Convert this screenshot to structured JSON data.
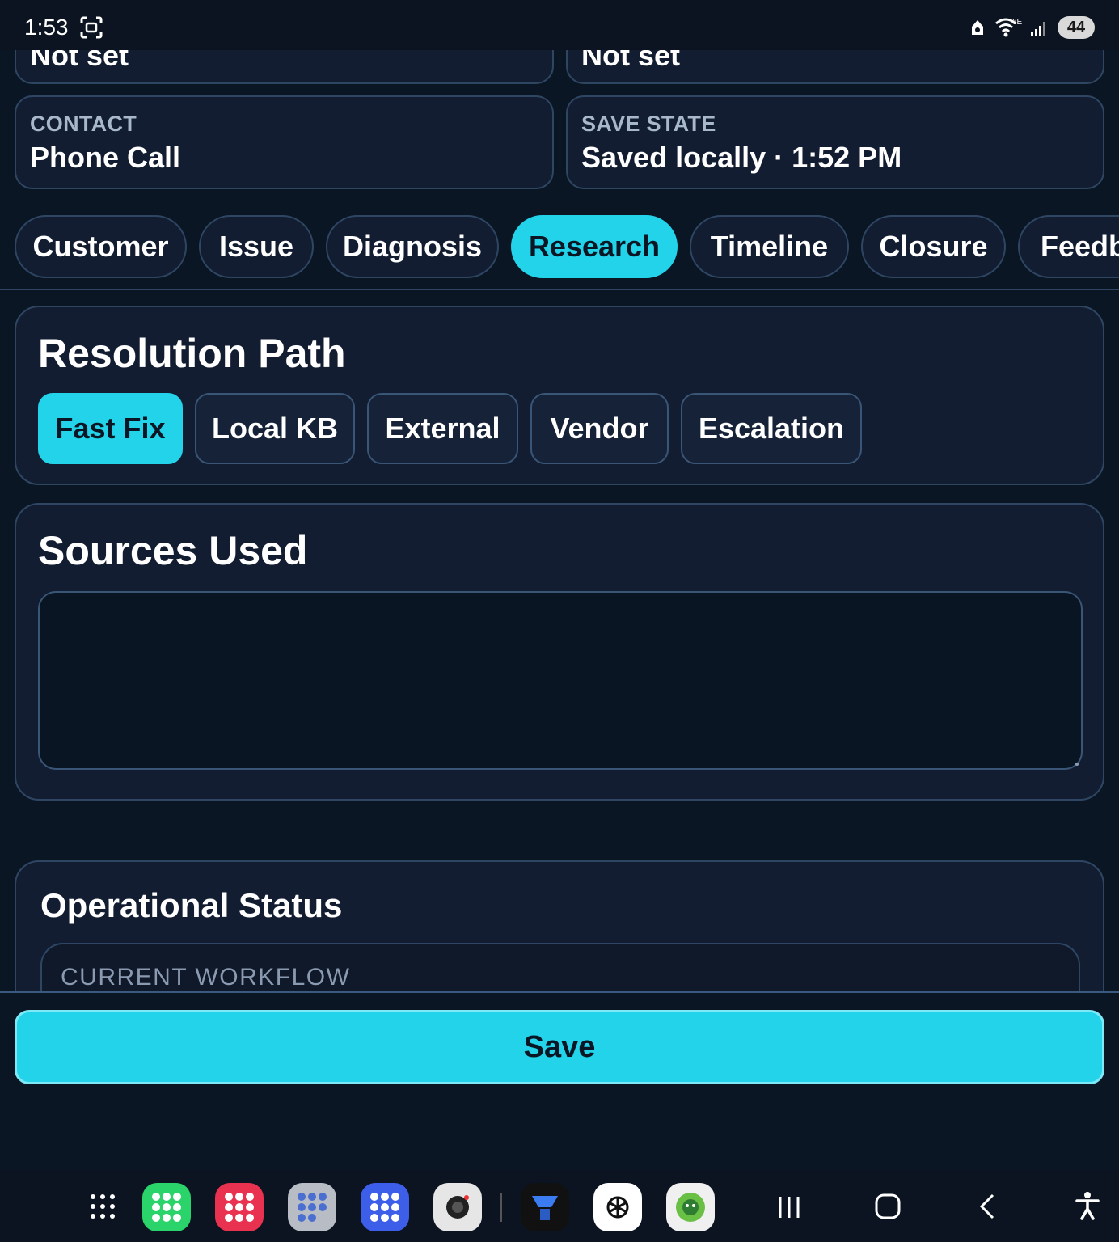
{
  "status_bar": {
    "time": "1:53",
    "network": "6E",
    "battery": "44"
  },
  "info_cards": {
    "top_left_value": "Not set",
    "top_right_value": "Not set",
    "contact_label": "CONTACT",
    "contact_value": "Phone Call",
    "save_state_label": "SAVE STATE",
    "save_state_value": "Saved locally · 1:52 PM"
  },
  "tabs": [
    {
      "label": "Customer",
      "active": false
    },
    {
      "label": "Issue",
      "active": false
    },
    {
      "label": "Diagnosis",
      "active": false
    },
    {
      "label": "Research",
      "active": true
    },
    {
      "label": "Timeline",
      "active": false
    },
    {
      "label": "Closure",
      "active": false
    },
    {
      "label": "Feedb",
      "active": false
    }
  ],
  "resolution_path": {
    "title": "Resolution Path",
    "options": [
      {
        "label": "Fast Fix",
        "active": true
      },
      {
        "label": "Local KB",
        "active": false
      },
      {
        "label": "External",
        "active": false
      },
      {
        "label": "Vendor",
        "active": false
      },
      {
        "label": "Escalation",
        "active": false
      }
    ]
  },
  "sources_used": {
    "title": "Sources Used",
    "value": ""
  },
  "operational_status": {
    "title": "Operational Status",
    "workflow_label": "CURRENT WORKFLOW"
  },
  "footer": {
    "save_label": "Save"
  },
  "colors": {
    "accent": "#22d3ea",
    "background": "#0b1625",
    "card": "#121d31",
    "border": "#2f4663"
  },
  "dock": {
    "apps": [
      "app-folder-green",
      "app-folder-red",
      "app-folder-gray",
      "app-folder-blue",
      "camera-app",
      "tf-app",
      "chatgpt-app",
      "android-app"
    ]
  }
}
